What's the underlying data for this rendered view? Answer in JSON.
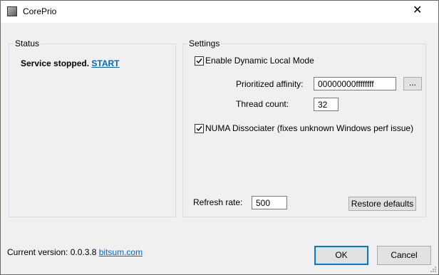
{
  "window": {
    "title": "CorePrio",
    "close_glyph": "✕"
  },
  "status": {
    "group_label": "Status",
    "state_text": "Service stopped.",
    "action_link": "START"
  },
  "settings": {
    "group_label": "Settings",
    "dynamic_local_mode": {
      "label": "Enable Dynamic Local Mode",
      "checked": true
    },
    "prioritized_affinity": {
      "label": "Prioritized affinity:",
      "value": "00000000ffffffff",
      "browse_label": "..."
    },
    "thread_count": {
      "label": "Thread count:",
      "value": "32"
    },
    "numa_dissociater": {
      "label": "NUMA Dissociater (fixes unknown Windows perf issue)",
      "checked": true
    },
    "refresh_rate": {
      "label": "Refresh rate:",
      "value": "500"
    },
    "restore_defaults_label": "Restore defaults"
  },
  "footer": {
    "version_text": "Current version: 0.0.3.8",
    "link_text": "bitsum.com"
  },
  "buttons": {
    "ok_label": "OK",
    "cancel_label": "Cancel"
  },
  "colors": {
    "link": "#0066cc",
    "accent": "#0078d7"
  },
  "icons": {
    "app": "app-icon",
    "close": "close-icon",
    "check": "checkmark-icon"
  }
}
